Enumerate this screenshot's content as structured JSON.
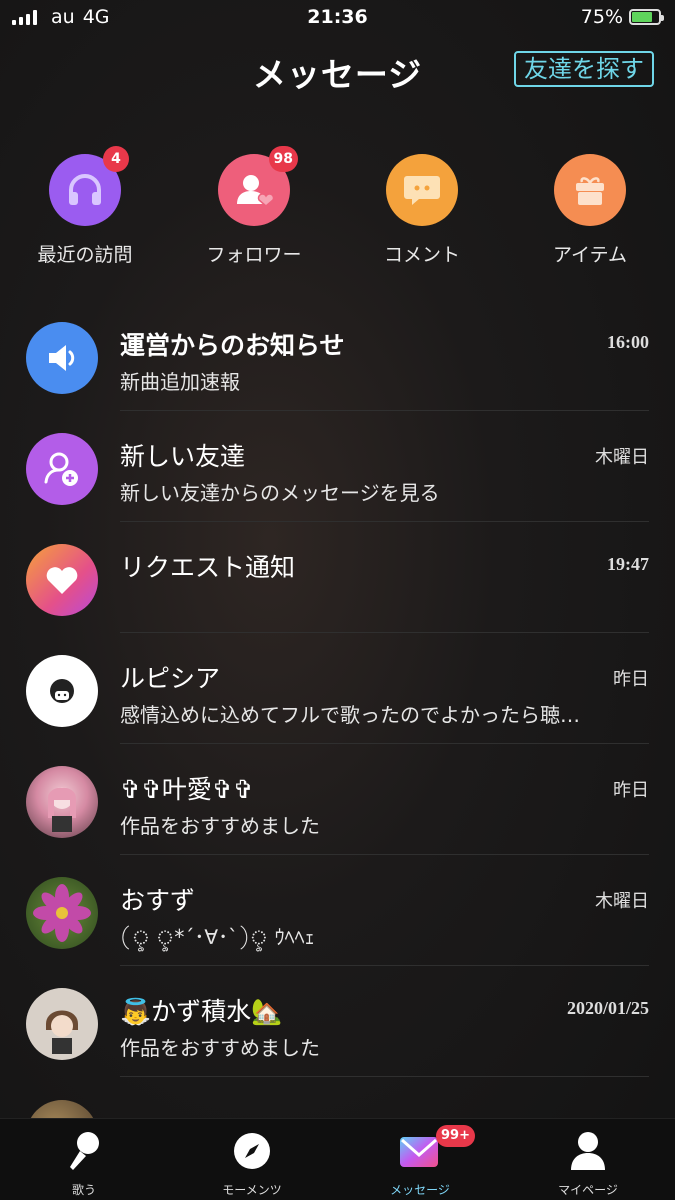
{
  "status_bar": {
    "carrier": "au",
    "network": "4G",
    "time": "21:36",
    "battery": "75%"
  },
  "header": {
    "title": "メッセージ",
    "find_friends": "友達を探す"
  },
  "quick_actions": [
    {
      "label": "最近の訪問",
      "badge": "4",
      "icon": "headphones-icon",
      "color": "#9b5cf0"
    },
    {
      "label": "フォロワー",
      "badge": "98",
      "icon": "person-heart-icon",
      "color": "#ee5f7b"
    },
    {
      "label": "コメント",
      "badge": "",
      "icon": "chat-bubble-icon",
      "color": "#f4a23c"
    },
    {
      "label": "アイテム",
      "badge": "",
      "icon": "gift-icon",
      "color": "#f58d52"
    }
  ],
  "messages": [
    {
      "name": "運営からのお知らせ",
      "preview": "新曲追加速報",
      "time": "16:00",
      "avatar": "speaker-icon"
    },
    {
      "name": "新しい友達",
      "preview": "新しい友達からのメッセージを見る",
      "time": "木曜日",
      "avatar": "new-friend-icon"
    },
    {
      "name": "リクエスト通知",
      "preview": "",
      "time": "19:47",
      "avatar": "heart-icon"
    },
    {
      "name": "ルピシア",
      "preview": "感情込めに込めてフルで歌ったのでよかったら聴…",
      "time": "昨日",
      "avatar": "user-avatar"
    },
    {
      "name": "✞✞叶愛✞✞",
      "preview": "作品をおすすめました",
      "time": "昨日",
      "avatar": "user-avatar"
    },
    {
      "name": "おすず",
      "preview": "(ৢ ৢ*´･∀･`)ৢ ｳﾍﾍｪ",
      "time": "木曜日",
      "avatar": "flower-avatar"
    },
    {
      "name": "👼かず積水🏡",
      "preview": "作品をおすすめました",
      "time": "2020/01/25",
      "avatar": "user-avatar"
    }
  ],
  "tabs": [
    {
      "label": "歌う",
      "icon": "microphone-icon"
    },
    {
      "label": "モーメンツ",
      "icon": "compass-icon"
    },
    {
      "label": "メッセージ",
      "icon": "envelope-icon",
      "badge": "99+"
    },
    {
      "label": "マイページ",
      "icon": "person-icon"
    }
  ]
}
